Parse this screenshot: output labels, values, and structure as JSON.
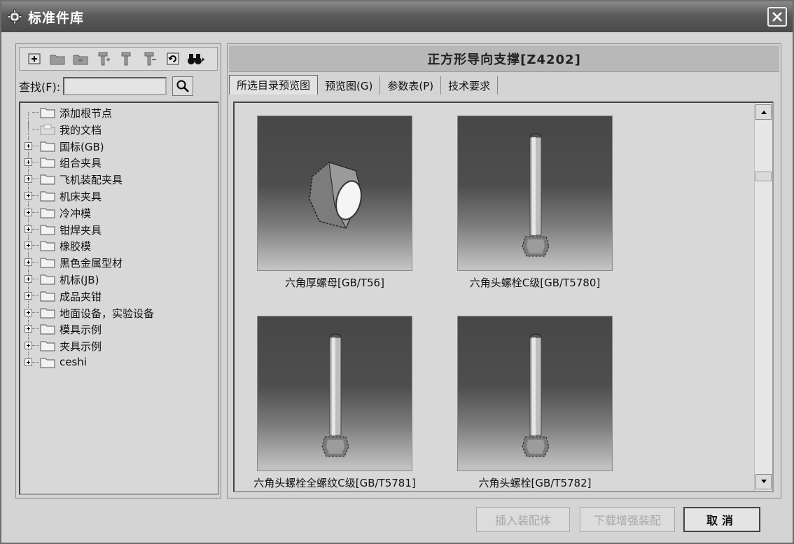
{
  "window": {
    "title": "标准件库"
  },
  "left": {
    "search_label": "查找(F):",
    "search_value": "",
    "tree": [
      {
        "label": "添加根节点",
        "expandable": false
      },
      {
        "label": "我的文档",
        "expandable": false
      },
      {
        "label": "国标(GB)",
        "expandable": true
      },
      {
        "label": "组合夹具",
        "expandable": true
      },
      {
        "label": "飞机装配夹具",
        "expandable": true
      },
      {
        "label": "机床夹具",
        "expandable": true
      },
      {
        "label": "冷冲模",
        "expandable": true
      },
      {
        "label": "钳焊夹具",
        "expandable": true
      },
      {
        "label": "橡胶模",
        "expandable": true
      },
      {
        "label": "黑色金属型材",
        "expandable": true
      },
      {
        "label": "机标(JB)",
        "expandable": true
      },
      {
        "label": "成品夹钳",
        "expandable": true
      },
      {
        "label": "地面设备，实验设备",
        "expandable": true
      },
      {
        "label": "模具示例",
        "expandable": true
      },
      {
        "label": "夹具示例",
        "expandable": true
      },
      {
        "label": "ceshi",
        "expandable": true
      }
    ]
  },
  "right": {
    "part_title": "正方形导向支撑[Z4202]",
    "tabs": [
      "所选目录预览图",
      "预览图(G)",
      "参数表(P)",
      "技术要求"
    ],
    "previews": [
      {
        "caption": "六角厚螺母[GB/T56]",
        "shape": "nut"
      },
      {
        "caption": "六角头螺栓C级[GB/T5780]",
        "shape": "bolt"
      },
      {
        "caption": "六角头螺栓全螺纹C级[GB/T5781]",
        "shape": "bolt"
      },
      {
        "caption": "六角头螺栓[GB/T5782]",
        "shape": "bolt"
      }
    ]
  },
  "buttons": {
    "insert": "插入装配体",
    "download": "下载增强装配",
    "cancel": "取消"
  }
}
